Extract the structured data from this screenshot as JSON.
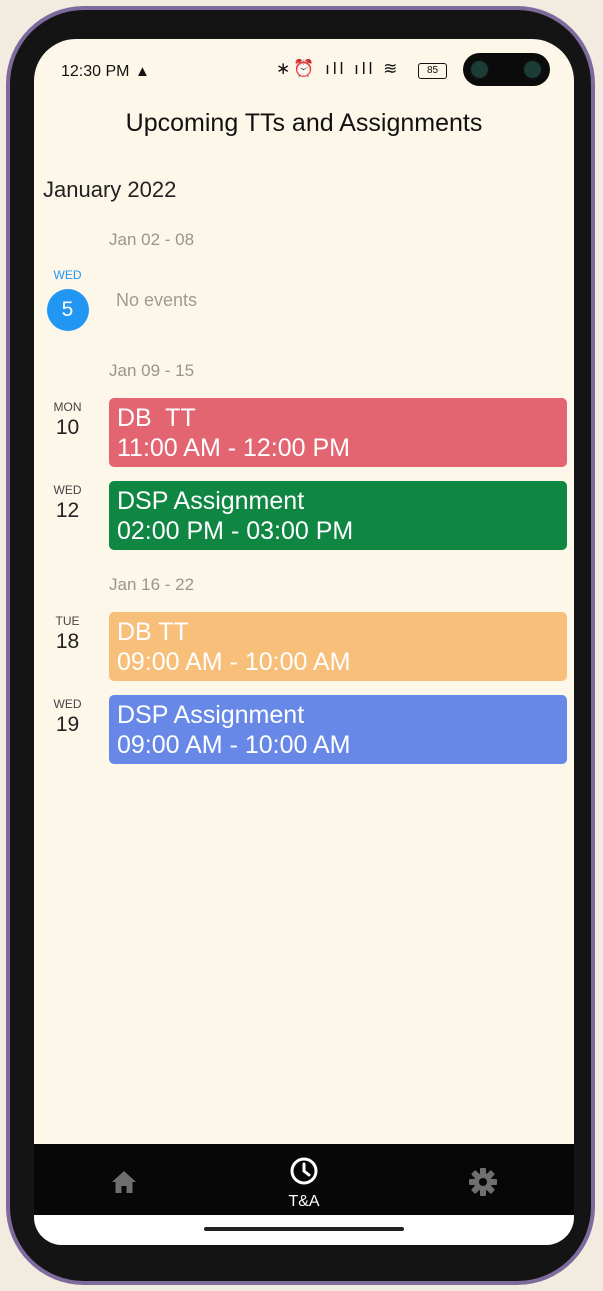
{
  "status_bar": {
    "time": "12:30 PM",
    "warning_symbol": "▲",
    "icons_text": "∗⏰ ıll ıll ≋",
    "battery": "85"
  },
  "header": {
    "title": "Upcoming TTs and Assignments"
  },
  "calendar": {
    "month": "January 2022",
    "weeks": [
      {
        "label": "Jan 02 - 08"
      },
      {
        "label": "Jan 09 - 15"
      },
      {
        "label": "Jan 16 - 22"
      }
    ],
    "today": {
      "dow": "WED",
      "day": "5",
      "empty_text": "No events"
    },
    "events": [
      {
        "dow": "MON",
        "day": "10",
        "title": "DB  TT",
        "time": "11:00 AM - 12:00 PM",
        "color": "#e36572"
      },
      {
        "dow": "WED",
        "day": "12",
        "title": "DSP Assignment",
        "time": "02:00 PM - 03:00 PM",
        "color": "#0f8743"
      },
      {
        "dow": "TUE",
        "day": "18",
        "title": "DB TT",
        "time": "09:00 AM - 10:00 AM",
        "color": "#f8bf7a"
      },
      {
        "dow": "WED",
        "day": "19",
        "title": "DSP Assignment",
        "time": "09:00 AM - 10:00 AM",
        "color": "#6788e6"
      }
    ]
  },
  "bottom_nav": {
    "items": [
      {
        "icon": "home-icon",
        "label": ""
      },
      {
        "icon": "clock-icon",
        "label": "T&A"
      },
      {
        "icon": "gear-icon",
        "label": ""
      }
    ],
    "active_color": "#ffffff",
    "inactive_color": "#6f6f6f"
  }
}
